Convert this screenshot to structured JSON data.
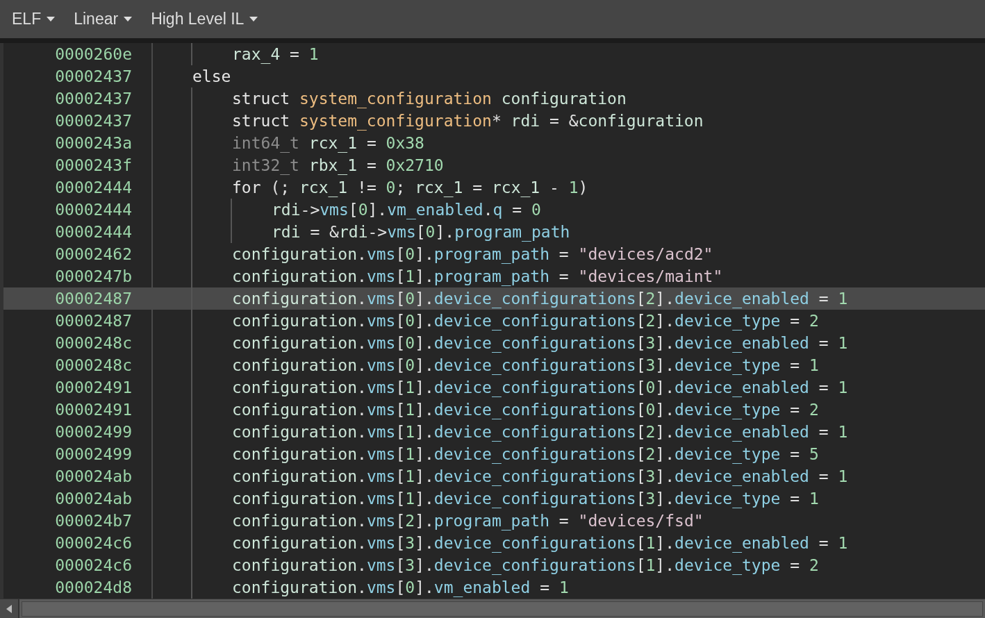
{
  "toolbar": {
    "menus": [
      {
        "label": "ELF"
      },
      {
        "label": "Linear"
      },
      {
        "label": "High Level IL"
      }
    ]
  },
  "code_view": {
    "lines": [
      {
        "children": [
          {
            "address": "0000260e",
            "selected": false,
            "tokens": [
              {
                "kind": "var",
                "text": "rax_4"
              },
              {
                "kind": "op",
                "text": " = "
              },
              {
                "kind": "num",
                "text": "1"
              }
            ]
          }
        ]
      },
      {
        "address": "00002437",
        "selected": false,
        "tokens": [
          {
            "kind": "kw",
            "text": "else"
          }
        ],
        "children": [
          {
            "address": "00002437",
            "selected": false,
            "tokens": [
              {
                "kind": "kw",
                "text": "struct "
              },
              {
                "kind": "type",
                "text": "system_configuration"
              },
              {
                "kind": "var",
                "text": " configuration"
              }
            ]
          },
          {
            "address": "00002437",
            "selected": false,
            "tokens": [
              {
                "kind": "kw",
                "text": "struct "
              },
              {
                "kind": "type",
                "text": "system_configuration"
              },
              {
                "kind": "op",
                "text": "* "
              },
              {
                "kind": "var",
                "text": "rdi"
              },
              {
                "kind": "op",
                "text": " = &"
              },
              {
                "kind": "var",
                "text": "configuration"
              }
            ]
          },
          {
            "address": "0000243a",
            "selected": false,
            "tokens": [
              {
                "kind": "prim",
                "text": "int64_t "
              },
              {
                "kind": "var",
                "text": "rcx_1"
              },
              {
                "kind": "op",
                "text": " = "
              },
              {
                "kind": "num",
                "text": "0x38"
              }
            ]
          },
          {
            "address": "0000243f",
            "selected": false,
            "tokens": [
              {
                "kind": "prim",
                "text": "int32_t "
              },
              {
                "kind": "var",
                "text": "rbx_1"
              },
              {
                "kind": "op",
                "text": " = "
              },
              {
                "kind": "num",
                "text": "0x2710"
              }
            ]
          },
          {
            "address": "00002444",
            "selected": false,
            "tokens": [
              {
                "kind": "kw",
                "text": "for"
              },
              {
                "kind": "op",
                "text": " (; "
              },
              {
                "kind": "var",
                "text": "rcx_1"
              },
              {
                "kind": "op",
                "text": " != "
              },
              {
                "kind": "num",
                "text": "0"
              },
              {
                "kind": "op",
                "text": "; "
              },
              {
                "kind": "var",
                "text": "rcx_1"
              },
              {
                "kind": "op",
                "text": " = "
              },
              {
                "kind": "var",
                "text": "rcx_1"
              },
              {
                "kind": "op",
                "text": " - "
              },
              {
                "kind": "num",
                "text": "1"
              },
              {
                "kind": "op",
                "text": ")"
              }
            ],
            "children": [
              {
                "address": "00002444",
                "selected": false,
                "tokens": [
                  {
                    "kind": "var",
                    "text": "rdi"
                  },
                  {
                    "kind": "op",
                    "text": "->"
                  },
                  {
                    "kind": "field",
                    "text": "vms"
                  },
                  {
                    "kind": "op",
                    "text": "["
                  },
                  {
                    "kind": "num",
                    "text": "0"
                  },
                  {
                    "kind": "op",
                    "text": "]."
                  },
                  {
                    "kind": "field",
                    "text": "vm_enabled"
                  },
                  {
                    "kind": "op",
                    "text": "."
                  },
                  {
                    "kind": "field",
                    "text": "q"
                  },
                  {
                    "kind": "op",
                    "text": " = "
                  },
                  {
                    "kind": "num",
                    "text": "0"
                  }
                ]
              },
              {
                "address": "00002444",
                "selected": false,
                "tokens": [
                  {
                    "kind": "var",
                    "text": "rdi"
                  },
                  {
                    "kind": "op",
                    "text": " = &"
                  },
                  {
                    "kind": "var",
                    "text": "rdi"
                  },
                  {
                    "kind": "op",
                    "text": "->"
                  },
                  {
                    "kind": "field",
                    "text": "vms"
                  },
                  {
                    "kind": "op",
                    "text": "["
                  },
                  {
                    "kind": "num",
                    "text": "0"
                  },
                  {
                    "kind": "op",
                    "text": "]."
                  },
                  {
                    "kind": "field",
                    "text": "program_path"
                  }
                ]
              }
            ]
          },
          {
            "address": "00002462",
            "selected": false,
            "tokens": [
              {
                "kind": "var",
                "text": "configuration"
              },
              {
                "kind": "op",
                "text": "."
              },
              {
                "kind": "field",
                "text": "vms"
              },
              {
                "kind": "op",
                "text": "["
              },
              {
                "kind": "num",
                "text": "0"
              },
              {
                "kind": "op",
                "text": "]."
              },
              {
                "kind": "field",
                "text": "program_path"
              },
              {
                "kind": "op",
                "text": " = "
              },
              {
                "kind": "str",
                "text": "\"devices/acd2\""
              }
            ]
          },
          {
            "address": "0000247b",
            "selected": false,
            "tokens": [
              {
                "kind": "var",
                "text": "configuration"
              },
              {
                "kind": "op",
                "text": "."
              },
              {
                "kind": "field",
                "text": "vms"
              },
              {
                "kind": "op",
                "text": "["
              },
              {
                "kind": "num",
                "text": "1"
              },
              {
                "kind": "op",
                "text": "]."
              },
              {
                "kind": "field",
                "text": "program_path"
              },
              {
                "kind": "op",
                "text": " = "
              },
              {
                "kind": "str",
                "text": "\"devices/maint\""
              }
            ]
          },
          {
            "address": "00002487",
            "selected": true,
            "tokens": [
              {
                "kind": "var",
                "text": "configuration"
              },
              {
                "kind": "op",
                "text": "."
              },
              {
                "kind": "field",
                "text": "vms"
              },
              {
                "kind": "op",
                "text": "["
              },
              {
                "kind": "num",
                "text": "0"
              },
              {
                "kind": "op",
                "text": "]."
              },
              {
                "kind": "field",
                "text": "device_configurations"
              },
              {
                "kind": "op",
                "text": "["
              },
              {
                "kind": "num",
                "text": "2"
              },
              {
                "kind": "op",
                "text": "]."
              },
              {
                "kind": "field",
                "text": "device_enabled"
              },
              {
                "kind": "op",
                "text": " = "
              },
              {
                "kind": "num",
                "text": "1"
              }
            ]
          },
          {
            "address": "00002487",
            "selected": false,
            "tokens": [
              {
                "kind": "var",
                "text": "configuration"
              },
              {
                "kind": "op",
                "text": "."
              },
              {
                "kind": "field",
                "text": "vms"
              },
              {
                "kind": "op",
                "text": "["
              },
              {
                "kind": "num",
                "text": "0"
              },
              {
                "kind": "op",
                "text": "]."
              },
              {
                "kind": "field",
                "text": "device_configurations"
              },
              {
                "kind": "op",
                "text": "["
              },
              {
                "kind": "num",
                "text": "2"
              },
              {
                "kind": "op",
                "text": "]."
              },
              {
                "kind": "field",
                "text": "device_type"
              },
              {
                "kind": "op",
                "text": " = "
              },
              {
                "kind": "num",
                "text": "2"
              }
            ]
          },
          {
            "address": "0000248c",
            "selected": false,
            "tokens": [
              {
                "kind": "var",
                "text": "configuration"
              },
              {
                "kind": "op",
                "text": "."
              },
              {
                "kind": "field",
                "text": "vms"
              },
              {
                "kind": "op",
                "text": "["
              },
              {
                "kind": "num",
                "text": "0"
              },
              {
                "kind": "op",
                "text": "]."
              },
              {
                "kind": "field",
                "text": "device_configurations"
              },
              {
                "kind": "op",
                "text": "["
              },
              {
                "kind": "num",
                "text": "3"
              },
              {
                "kind": "op",
                "text": "]."
              },
              {
                "kind": "field",
                "text": "device_enabled"
              },
              {
                "kind": "op",
                "text": " = "
              },
              {
                "kind": "num",
                "text": "1"
              }
            ]
          },
          {
            "address": "0000248c",
            "selected": false,
            "tokens": [
              {
                "kind": "var",
                "text": "configuration"
              },
              {
                "kind": "op",
                "text": "."
              },
              {
                "kind": "field",
                "text": "vms"
              },
              {
                "kind": "op",
                "text": "["
              },
              {
                "kind": "num",
                "text": "0"
              },
              {
                "kind": "op",
                "text": "]."
              },
              {
                "kind": "field",
                "text": "device_configurations"
              },
              {
                "kind": "op",
                "text": "["
              },
              {
                "kind": "num",
                "text": "3"
              },
              {
                "kind": "op",
                "text": "]."
              },
              {
                "kind": "field",
                "text": "device_type"
              },
              {
                "kind": "op",
                "text": " = "
              },
              {
                "kind": "num",
                "text": "1"
              }
            ]
          },
          {
            "address": "00002491",
            "selected": false,
            "tokens": [
              {
                "kind": "var",
                "text": "configuration"
              },
              {
                "kind": "op",
                "text": "."
              },
              {
                "kind": "field",
                "text": "vms"
              },
              {
                "kind": "op",
                "text": "["
              },
              {
                "kind": "num",
                "text": "1"
              },
              {
                "kind": "op",
                "text": "]."
              },
              {
                "kind": "field",
                "text": "device_configurations"
              },
              {
                "kind": "op",
                "text": "["
              },
              {
                "kind": "num",
                "text": "0"
              },
              {
                "kind": "op",
                "text": "]."
              },
              {
                "kind": "field",
                "text": "device_enabled"
              },
              {
                "kind": "op",
                "text": " = "
              },
              {
                "kind": "num",
                "text": "1"
              }
            ]
          },
          {
            "address": "00002491",
            "selected": false,
            "tokens": [
              {
                "kind": "var",
                "text": "configuration"
              },
              {
                "kind": "op",
                "text": "."
              },
              {
                "kind": "field",
                "text": "vms"
              },
              {
                "kind": "op",
                "text": "["
              },
              {
                "kind": "num",
                "text": "1"
              },
              {
                "kind": "op",
                "text": "]."
              },
              {
                "kind": "field",
                "text": "device_configurations"
              },
              {
                "kind": "op",
                "text": "["
              },
              {
                "kind": "num",
                "text": "0"
              },
              {
                "kind": "op",
                "text": "]."
              },
              {
                "kind": "field",
                "text": "device_type"
              },
              {
                "kind": "op",
                "text": " = "
              },
              {
                "kind": "num",
                "text": "2"
              }
            ]
          },
          {
            "address": "00002499",
            "selected": false,
            "tokens": [
              {
                "kind": "var",
                "text": "configuration"
              },
              {
                "kind": "op",
                "text": "."
              },
              {
                "kind": "field",
                "text": "vms"
              },
              {
                "kind": "op",
                "text": "["
              },
              {
                "kind": "num",
                "text": "1"
              },
              {
                "kind": "op",
                "text": "]."
              },
              {
                "kind": "field",
                "text": "device_configurations"
              },
              {
                "kind": "op",
                "text": "["
              },
              {
                "kind": "num",
                "text": "2"
              },
              {
                "kind": "op",
                "text": "]."
              },
              {
                "kind": "field",
                "text": "device_enabled"
              },
              {
                "kind": "op",
                "text": " = "
              },
              {
                "kind": "num",
                "text": "1"
              }
            ]
          },
          {
            "address": "00002499",
            "selected": false,
            "tokens": [
              {
                "kind": "var",
                "text": "configuration"
              },
              {
                "kind": "op",
                "text": "."
              },
              {
                "kind": "field",
                "text": "vms"
              },
              {
                "kind": "op",
                "text": "["
              },
              {
                "kind": "num",
                "text": "1"
              },
              {
                "kind": "op",
                "text": "]."
              },
              {
                "kind": "field",
                "text": "device_configurations"
              },
              {
                "kind": "op",
                "text": "["
              },
              {
                "kind": "num",
                "text": "2"
              },
              {
                "kind": "op",
                "text": "]."
              },
              {
                "kind": "field",
                "text": "device_type"
              },
              {
                "kind": "op",
                "text": " = "
              },
              {
                "kind": "num",
                "text": "5"
              }
            ]
          },
          {
            "address": "000024ab",
            "selected": false,
            "tokens": [
              {
                "kind": "var",
                "text": "configuration"
              },
              {
                "kind": "op",
                "text": "."
              },
              {
                "kind": "field",
                "text": "vms"
              },
              {
                "kind": "op",
                "text": "["
              },
              {
                "kind": "num",
                "text": "1"
              },
              {
                "kind": "op",
                "text": "]."
              },
              {
                "kind": "field",
                "text": "device_configurations"
              },
              {
                "kind": "op",
                "text": "["
              },
              {
                "kind": "num",
                "text": "3"
              },
              {
                "kind": "op",
                "text": "]."
              },
              {
                "kind": "field",
                "text": "device_enabled"
              },
              {
                "kind": "op",
                "text": " = "
              },
              {
                "kind": "num",
                "text": "1"
              }
            ]
          },
          {
            "address": "000024ab",
            "selected": false,
            "tokens": [
              {
                "kind": "var",
                "text": "configuration"
              },
              {
                "kind": "op",
                "text": "."
              },
              {
                "kind": "field",
                "text": "vms"
              },
              {
                "kind": "op",
                "text": "["
              },
              {
                "kind": "num",
                "text": "1"
              },
              {
                "kind": "op",
                "text": "]."
              },
              {
                "kind": "field",
                "text": "device_configurations"
              },
              {
                "kind": "op",
                "text": "["
              },
              {
                "kind": "num",
                "text": "3"
              },
              {
                "kind": "op",
                "text": "]."
              },
              {
                "kind": "field",
                "text": "device_type"
              },
              {
                "kind": "op",
                "text": " = "
              },
              {
                "kind": "num",
                "text": "1"
              }
            ]
          },
          {
            "address": "000024b7",
            "selected": false,
            "tokens": [
              {
                "kind": "var",
                "text": "configuration"
              },
              {
                "kind": "op",
                "text": "."
              },
              {
                "kind": "field",
                "text": "vms"
              },
              {
                "kind": "op",
                "text": "["
              },
              {
                "kind": "num",
                "text": "2"
              },
              {
                "kind": "op",
                "text": "]."
              },
              {
                "kind": "field",
                "text": "program_path"
              },
              {
                "kind": "op",
                "text": " = "
              },
              {
                "kind": "str",
                "text": "\"devices/fsd\""
              }
            ]
          },
          {
            "address": "000024c6",
            "selected": false,
            "tokens": [
              {
                "kind": "var",
                "text": "configuration"
              },
              {
                "kind": "op",
                "text": "."
              },
              {
                "kind": "field",
                "text": "vms"
              },
              {
                "kind": "op",
                "text": "["
              },
              {
                "kind": "num",
                "text": "3"
              },
              {
                "kind": "op",
                "text": "]."
              },
              {
                "kind": "field",
                "text": "device_configurations"
              },
              {
                "kind": "op",
                "text": "["
              },
              {
                "kind": "num",
                "text": "1"
              },
              {
                "kind": "op",
                "text": "]."
              },
              {
                "kind": "field",
                "text": "device_enabled"
              },
              {
                "kind": "op",
                "text": " = "
              },
              {
                "kind": "num",
                "text": "1"
              }
            ]
          },
          {
            "address": "000024c6",
            "selected": false,
            "tokens": [
              {
                "kind": "var",
                "text": "configuration"
              },
              {
                "kind": "op",
                "text": "."
              },
              {
                "kind": "field",
                "text": "vms"
              },
              {
                "kind": "op",
                "text": "["
              },
              {
                "kind": "num",
                "text": "3"
              },
              {
                "kind": "op",
                "text": "]."
              },
              {
                "kind": "field",
                "text": "device_configurations"
              },
              {
                "kind": "op",
                "text": "["
              },
              {
                "kind": "num",
                "text": "1"
              },
              {
                "kind": "op",
                "text": "]."
              },
              {
                "kind": "field",
                "text": "device_type"
              },
              {
                "kind": "op",
                "text": " = "
              },
              {
                "kind": "num",
                "text": "2"
              }
            ]
          },
          {
            "address": "000024d8",
            "selected": false,
            "tokens": [
              {
                "kind": "var",
                "text": "configuration"
              },
              {
                "kind": "op",
                "text": "."
              },
              {
                "kind": "field",
                "text": "vms"
              },
              {
                "kind": "op",
                "text": "["
              },
              {
                "kind": "num",
                "text": "0"
              },
              {
                "kind": "op",
                "text": "]."
              },
              {
                "kind": "field",
                "text": "vm_enabled"
              },
              {
                "kind": "op",
                "text": " = "
              },
              {
                "kind": "num",
                "text": "1"
              }
            ]
          }
        ]
      }
    ]
  }
}
